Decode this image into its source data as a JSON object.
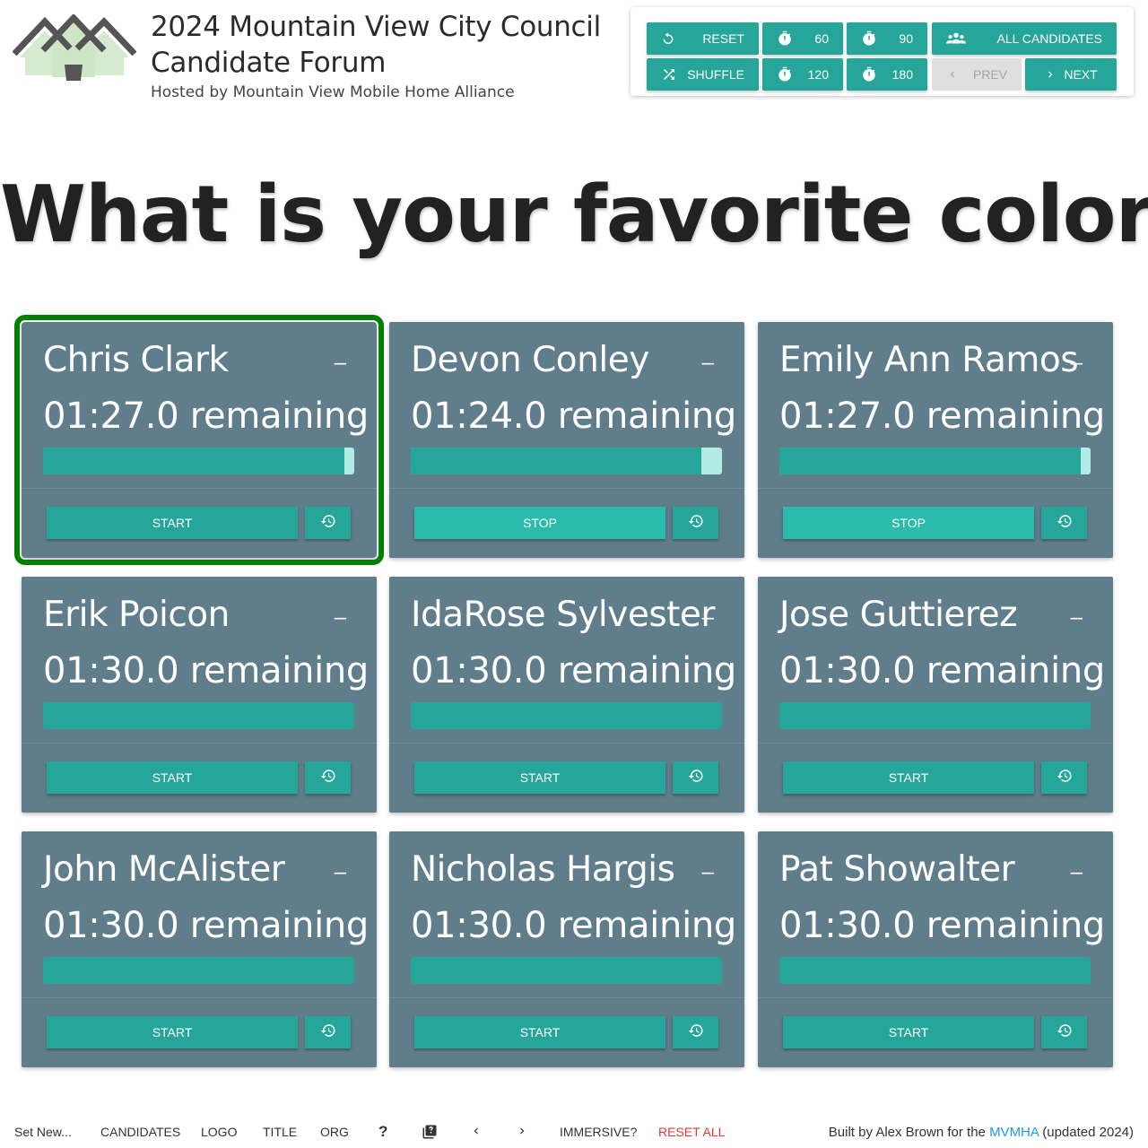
{
  "header": {
    "title": "2024 Mountain View City Council Candidate Forum",
    "subtitle": "Hosted by Mountain View Mobile Home Alliance"
  },
  "controls": {
    "reset": "RESET",
    "shuffle": "SHUFFLE",
    "t60": "60",
    "t120": "120",
    "t90": "90",
    "t180": "180",
    "all_candidates": "ALL CANDIDATES",
    "prev": "PREV",
    "next": "NEXT"
  },
  "question": "What is your favorite color?",
  "candidates": [
    {
      "name": "Chris Clark",
      "remaining": "01:27.0 remaining",
      "progress": 0.967,
      "button": "START",
      "selected": true,
      "running": false
    },
    {
      "name": "Devon Conley",
      "remaining": "01:24.0 remaining",
      "progress": 0.933,
      "button": "STOP",
      "selected": false,
      "running": true
    },
    {
      "name": "Emily Ann Ramos",
      "remaining": "01:27.0 remaining",
      "progress": 0.967,
      "button": "STOP",
      "selected": false,
      "running": true
    },
    {
      "name": "Erik Poicon",
      "remaining": "01:30.0 remaining",
      "progress": 1.0,
      "button": "START",
      "selected": false,
      "running": false
    },
    {
      "name": "IdaRose Sylvester",
      "remaining": "01:30.0 remaining",
      "progress": 1.0,
      "button": "START",
      "selected": false,
      "running": false
    },
    {
      "name": "Jose Guttierez",
      "remaining": "01:30.0 remaining",
      "progress": 1.0,
      "button": "START",
      "selected": false,
      "running": false
    },
    {
      "name": "John McAlister",
      "remaining": "01:30.0 remaining",
      "progress": 1.0,
      "button": "START",
      "selected": false,
      "running": false
    },
    {
      "name": "Nicholas Hargis",
      "remaining": "01:30.0 remaining",
      "progress": 1.0,
      "button": "START",
      "selected": false,
      "running": false
    },
    {
      "name": "Pat Showalter",
      "remaining": "01:30.0 remaining",
      "progress": 1.0,
      "button": "START",
      "selected": false,
      "running": false
    }
  ],
  "footer": {
    "set_new": "Set New...",
    "candidates": "CANDIDATES",
    "logo": "LOGO",
    "title": "TITLE",
    "org": "ORG",
    "help": "?",
    "immersive": "IMMERSIVE?",
    "reset_all": "RESET ALL",
    "credits_prefix": "Built by Alex Brown for the ",
    "credits_link": "MVMHA",
    "credits_suffix": " (updated 2024)"
  },
  "colors": {
    "accent": "#26a69a",
    "card": "#607d8b",
    "selected_outline": "#008000",
    "danger": "#e53935",
    "link": "#2196f3"
  }
}
